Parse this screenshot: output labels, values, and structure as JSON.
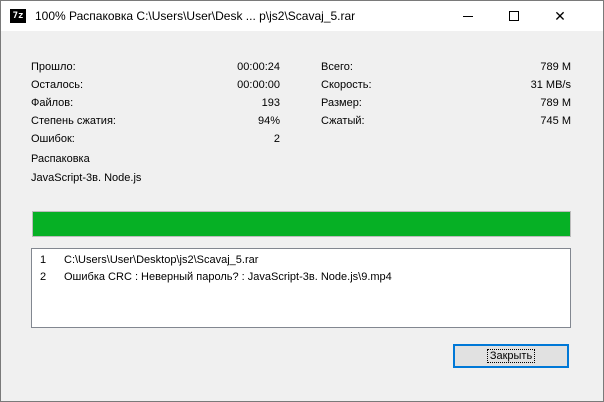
{
  "window": {
    "app_icon_label": "7z",
    "title": "100% Распаковка C:\\Users\\User\\Desk ... p\\js2\\Scavaj_5.rar",
    "minimize_glyph": "–",
    "maximize_glyph": "☐",
    "close_glyph": "✕"
  },
  "stats_left": [
    {
      "label": "Прошло:",
      "value": "00:00:24"
    },
    {
      "label": "Осталось:",
      "value": "00:00:00"
    },
    {
      "label": "Файлов:",
      "value": "193"
    },
    {
      "label": "Степень сжатия:",
      "value": "94%"
    },
    {
      "label": "Ошибок:",
      "value": "2"
    }
  ],
  "stats_right": [
    {
      "label": "Всего:",
      "value": "789 M"
    },
    {
      "label": "Скорость:",
      "value": "31 MB/s"
    },
    {
      "label": "Размер:",
      "value": "789 M"
    },
    {
      "label": "Сжатый:",
      "value": "745 M"
    }
  ],
  "status": {
    "operation": "Распаковка",
    "current_item": "JavaScript-3в. Node.js"
  },
  "progress": {
    "percent": 100
  },
  "log": [
    {
      "num": "1",
      "text": "C:\\Users\\User\\Desktop\\js2\\Scavaj_5.rar"
    },
    {
      "num": "2",
      "text": "Ошибка CRC : Неверный пароль? : JavaScript-3в. Node.js\\9.mp4"
    }
  ],
  "buttons": {
    "close_label": "Закрыть"
  },
  "colors": {
    "progress": "#06b025",
    "focus": "#0078d7"
  }
}
